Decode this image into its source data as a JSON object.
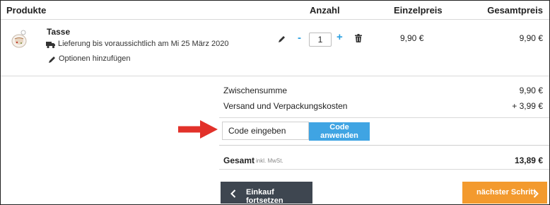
{
  "table": {
    "headers": {
      "products": "Produkte",
      "quantity": "Anzahl",
      "unit_price": "Einzelpreis",
      "total_price": "Gesamtpreis"
    }
  },
  "item": {
    "name": "Tasse",
    "delivery": "Lieferung bis voraussichtlich am Mi 25 März 2020",
    "options_link": "Optionen hinzufügen",
    "quantity": "1",
    "qty_minus": "-",
    "qty_plus": "+",
    "unit_price": "9,90 €",
    "total_price": "9,90 €"
  },
  "summary": {
    "subtotal_label": "Zwischensumme",
    "subtotal_value": "9,90 €",
    "shipping_label": "Versand und Verpackungskosten",
    "shipping_value": "+ 3,99 €",
    "total_label": "Gesamt",
    "total_note": "inkl. MwSt.",
    "total_value": "13,89 €"
  },
  "coupon": {
    "placeholder": "Code eingeben",
    "button_label": "Code anwenden"
  },
  "nav": {
    "back_label": "Einkauf fortsetzen",
    "next_label": "nächster Schritt"
  },
  "icons": {
    "delivery": "truck-icon",
    "edit": "pencil-icon",
    "delete": "trash-icon",
    "back": "chevron-left-icon",
    "next": "chevron-right-icon",
    "annotation": "red-arrow-icon"
  },
  "colors": {
    "accent_blue": "#3fa4e3",
    "back_button": "#3e4650",
    "next_button": "#f39a2e",
    "arrow_red": "#e2312a"
  }
}
